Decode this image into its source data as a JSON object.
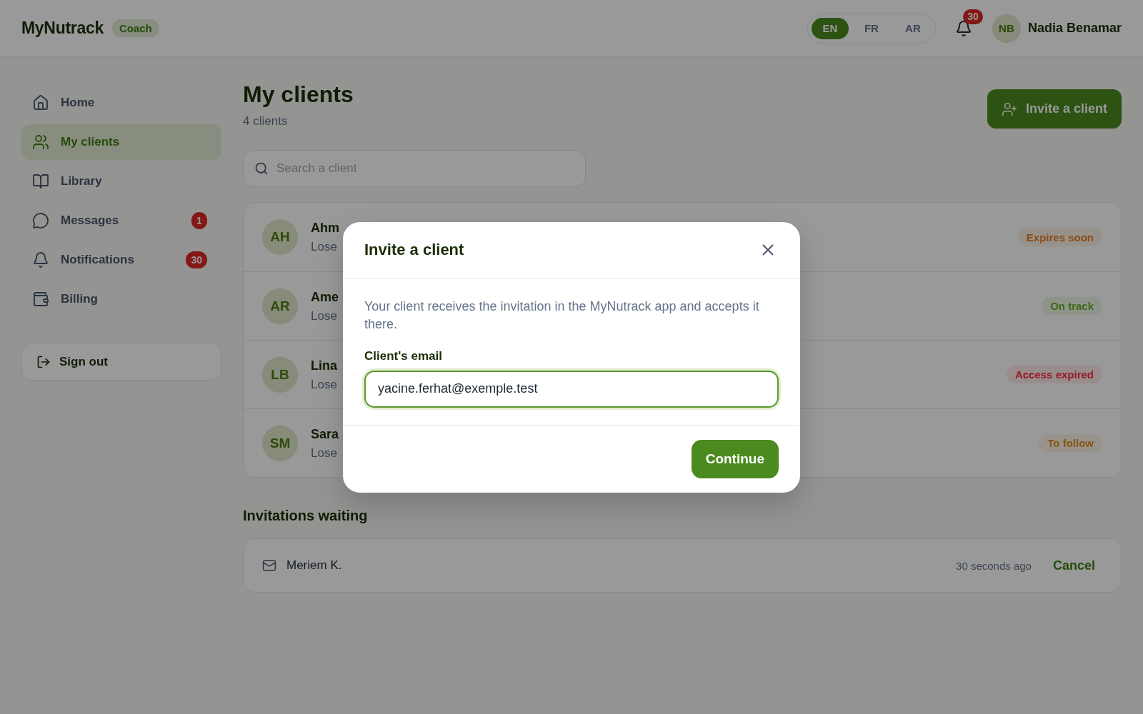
{
  "header": {
    "logo": "MyNutrack",
    "role_badge": "Coach",
    "languages": [
      {
        "label": "EN",
        "selected": true
      },
      {
        "label": "FR",
        "selected": false
      },
      {
        "label": "AR",
        "selected": false
      }
    ],
    "notification_count": "30",
    "user": {
      "initials": "NB",
      "name": "Nadia Benamar"
    }
  },
  "sidebar": {
    "items": [
      {
        "label": "Home",
        "selected": false
      },
      {
        "label": "My clients",
        "selected": true
      },
      {
        "label": "Library",
        "selected": false
      },
      {
        "label": "Messages",
        "selected": false,
        "badge": "1"
      },
      {
        "label": "Notifications",
        "selected": false,
        "badge": "30"
      },
      {
        "label": "Billing",
        "selected": false
      }
    ],
    "sign_out": "Sign out"
  },
  "page": {
    "title": "My clients",
    "count": "4 clients",
    "invite_button": "Invite a client",
    "search": {
      "placeholder": "Search a client"
    }
  },
  "clients": [
    {
      "initials": "AH",
      "name": "Ahm",
      "subtitle": "Lose",
      "status": {
        "label": "Expires soon",
        "color": "#8c4b14"
      }
    },
    {
      "initials": "AR",
      "name": "Ame",
      "subtitle": "Lose",
      "status": {
        "label": "On track",
        "color": "#3c6914"
      }
    },
    {
      "initials": "LB",
      "name": "Lina",
      "subtitle": "Lose",
      "status": {
        "label": "Access expired",
        "color": "#961923"
      }
    },
    {
      "initials": "SM",
      "name": "Sara",
      "subtitle": "Lose",
      "status": {
        "label": "To follow",
        "color": "#87550f"
      }
    }
  ],
  "invitations": {
    "title": "Invitations waiting",
    "items": [
      {
        "name": "Meriem K.",
        "time": "30 seconds ago",
        "action": "Cancel"
      }
    ]
  },
  "modal": {
    "title": "Invite a client",
    "description": "Your client receives the invitation in the MyNutrack app and accepts it there.",
    "field": {
      "label": "Client's email",
      "value": "yacine.ferhat@exemple.test"
    },
    "button": "Continue"
  }
}
